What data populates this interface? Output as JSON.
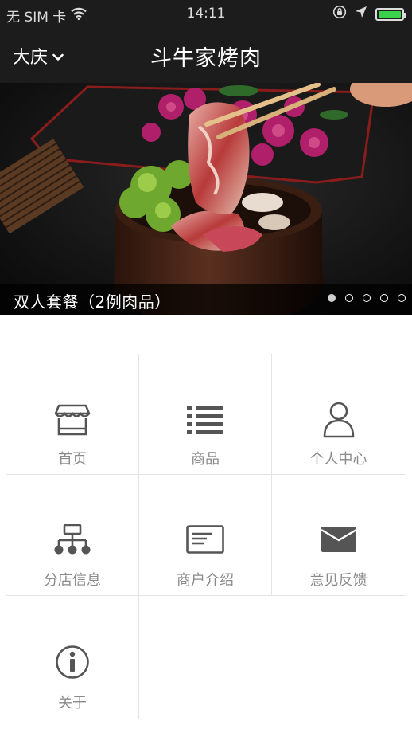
{
  "status_bar": {
    "carrier": "无 SIM 卡",
    "time": "14:11",
    "battery_level": 1.0,
    "icons": [
      "wifi-icon",
      "orientation-lock-icon",
      "location-arrow-icon",
      "battery-icon"
    ]
  },
  "nav": {
    "city": "大庆",
    "title": "斗牛家烤肉"
  },
  "banner": {
    "caption": "双人套餐（2例肉品）",
    "slide_count": 5,
    "active_slide": 1
  },
  "menu": {
    "items": [
      {
        "label": "首页",
        "icon": "storefront-icon"
      },
      {
        "label": "商品",
        "icon": "list-icon"
      },
      {
        "label": "个人中心",
        "icon": "user-icon"
      },
      {
        "label": "分店信息",
        "icon": "sitemap-icon"
      },
      {
        "label": "商户介绍",
        "icon": "card-icon"
      },
      {
        "label": "意见反馈",
        "icon": "envelope-icon"
      },
      {
        "label": "关于",
        "icon": "info-icon"
      }
    ]
  },
  "colors": {
    "bar_background": "#1c1c1c",
    "battery": "#39d24a",
    "menu_icon": "#555555",
    "menu_label": "#8a8a8a",
    "divider": "#e3e3e3"
  }
}
